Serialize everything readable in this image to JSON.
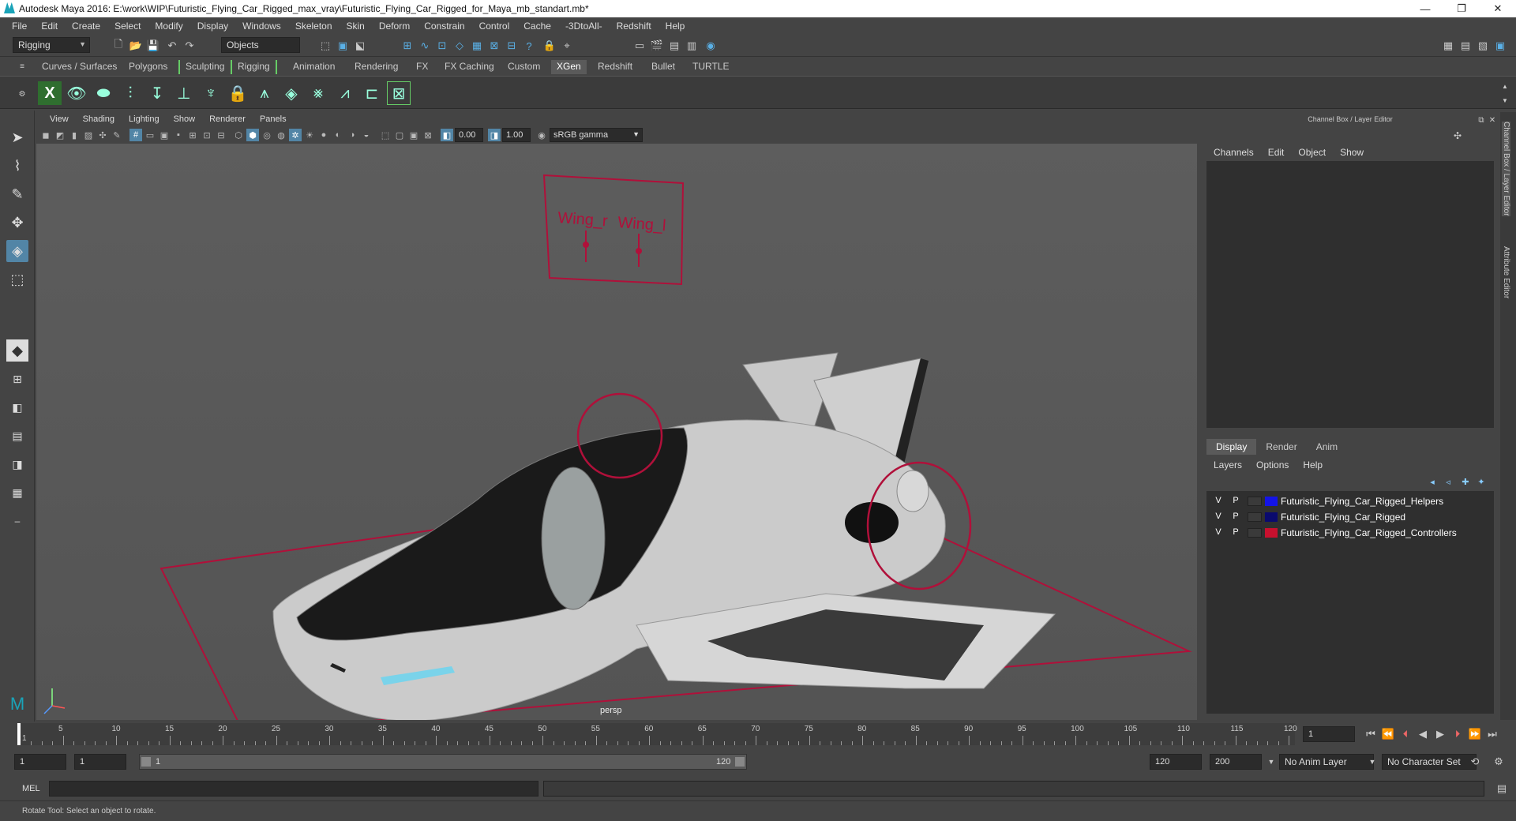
{
  "window": {
    "title": "Autodesk Maya 2016: E:\\work\\WIP\\Futuristic_Flying_Car_Rigged_max_vray\\Futuristic_Flying_Car_Rigged_for_Maya_mb_standart.mb*",
    "minimize": "—",
    "maximize": "❐",
    "close": "✕"
  },
  "menubar": [
    "File",
    "Edit",
    "Create",
    "Select",
    "Modify",
    "Display",
    "Windows",
    "Skeleton",
    "Skin",
    "Deform",
    "Constrain",
    "Control",
    "Cache",
    "-3DtoAll-",
    "Redshift",
    "Help"
  ],
  "statusline": {
    "mode": "Rigging",
    "selection_mode": "Objects"
  },
  "shelf_tabs": [
    {
      "label": "Curves / Surfaces"
    },
    {
      "label": "Polygons"
    },
    {
      "label": "Sculpting"
    },
    {
      "label": "Rigging"
    },
    {
      "label": "Animation"
    },
    {
      "label": "Rendering"
    },
    {
      "label": "FX"
    },
    {
      "label": "FX Caching"
    },
    {
      "label": "Custom"
    },
    {
      "label": "XGen",
      "active": true
    },
    {
      "label": "Redshift"
    },
    {
      "label": "Bullet"
    },
    {
      "label": "TURTLE"
    }
  ],
  "viewport": {
    "menu": [
      "View",
      "Shading",
      "Lighting",
      "Show",
      "Renderer",
      "Panels"
    ],
    "exposure": "0.00",
    "gamma": "1.00",
    "color_space": "sRGB gamma",
    "camera_label": "persp",
    "annotations": {
      "wing_r": "Wing_r",
      "wing_l": "Wing_l"
    },
    "controller_color": "#b0103a",
    "body_color": "#c8c8c8"
  },
  "channel_box": {
    "title": "Channel Box / Layer Editor",
    "menu": [
      "Channels",
      "Edit",
      "Object",
      "Show"
    ]
  },
  "layer_editor": {
    "tabs": [
      {
        "label": "Display",
        "active": true
      },
      {
        "label": "Render"
      },
      {
        "label": "Anim"
      }
    ],
    "menu": [
      "Layers",
      "Options",
      "Help"
    ],
    "layers": [
      {
        "v": "V",
        "p": "P",
        "color": "#1414e6",
        "name": "Futuristic_Flying_Car_Rigged_Helpers"
      },
      {
        "v": "V",
        "p": "P",
        "color": "#0a0a6e",
        "name": "Futuristic_Flying_Car_Rigged"
      },
      {
        "v": "V",
        "p": "P",
        "color": "#c8102e",
        "name": "Futuristic_Flying_Car_Rigged_Controllers"
      }
    ]
  },
  "side_tabs": [
    "Channel Box / Layer Editor",
    "Attribute Editor"
  ],
  "timeline": {
    "ticks": [
      "5",
      "10",
      "15",
      "20",
      "25",
      "30",
      "35",
      "40",
      "45",
      "50",
      "55",
      "60",
      "65",
      "70",
      "75",
      "80",
      "85",
      "90",
      "95",
      "100",
      "105",
      "110",
      "115",
      "120"
    ],
    "start_marker": "1",
    "current_frame": "1"
  },
  "range": {
    "start": "1",
    "anim_start": "1",
    "slider_start": "1",
    "slider_end": "120",
    "anim_end": "120",
    "end": "200",
    "anim_layer": "No Anim Layer",
    "character_set": "No Character Set"
  },
  "command_line": {
    "label": "MEL"
  },
  "help_line": {
    "text": "Rotate Tool: Select an object to rotate."
  }
}
